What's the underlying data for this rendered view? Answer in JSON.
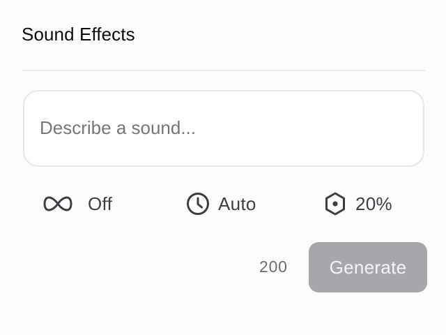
{
  "panel": {
    "title": "Sound Effects"
  },
  "prompt": {
    "placeholder": "Describe a sound...",
    "value": ""
  },
  "options": {
    "loop": {
      "icon": "infinity-icon",
      "label": "Off"
    },
    "duration": {
      "icon": "clock-icon",
      "label": "Auto"
    },
    "prompt_influence": {
      "icon": "hexagon-dot-icon",
      "label": "20%"
    }
  },
  "footer": {
    "char_count": "200",
    "generate_label": "Generate"
  },
  "colors": {
    "background": "#fdfcfd",
    "button_disabled": "#a8a5ab",
    "icon": "#3f3d43"
  }
}
